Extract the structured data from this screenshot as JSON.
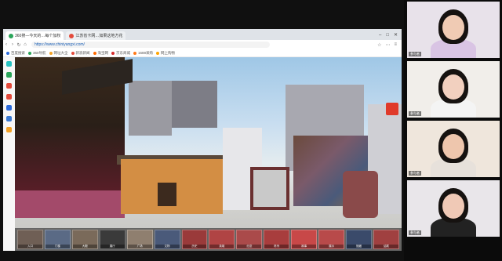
{
  "browser": {
    "tabs": [
      {
        "label": "360搜—今天的…每个加权",
        "color": "#2aa55a"
      },
      {
        "label": "江苏省卡网…如果这地方花",
        "color": "#e34a3b"
      }
    ],
    "url": "https://www.chiniyangxi.com/",
    "bookmarks": [
      {
        "label": "百度搜索",
        "color": "#2b6bdc"
      },
      {
        "label": "360导航",
        "color": "#2aa55a"
      },
      {
        "label": "网址大全",
        "color": "#f2a227"
      },
      {
        "label": "新浪新闻",
        "color": "#e34a3b"
      },
      {
        "label": "淘宝网",
        "color": "#ff6a00"
      },
      {
        "label": "京东商城",
        "color": "#d52b2b"
      },
      {
        "label": "1688采购",
        "color": "#ff7a1a"
      },
      {
        "label": "网上购物",
        "color": "#ffa500"
      }
    ]
  },
  "panorama": {
    "thumbnails": [
      {
        "label": "入口",
        "color": "#6f5f55"
      },
      {
        "label": "门楼",
        "color": "#5a6a85"
      },
      {
        "label": "大殿",
        "color": "#7a6a5a"
      },
      {
        "label": "展厅",
        "color": "#3a3a3a"
      },
      {
        "label": "广场",
        "color": "#8f7f6f"
      },
      {
        "label": "文物",
        "color": "#4a5a7a"
      },
      {
        "label": "历史",
        "color": "#9a3a3a"
      },
      {
        "label": "英雄",
        "color": "#b04444"
      },
      {
        "label": "纪念",
        "color": "#aa4a4a"
      },
      {
        "label": "陈列",
        "color": "#a83d3d"
      },
      {
        "label": "故事",
        "color": "#c84848"
      },
      {
        "label": "展示",
        "color": "#b84a4a"
      },
      {
        "label": "馆藏",
        "color": "#3a4a6a"
      },
      {
        "label": "结尾",
        "color": "#a04040"
      }
    ]
  },
  "participants": [
    {
      "label": "参与者",
      "bg": "#e8e2ea",
      "skin": "#f0cbb4",
      "shirt": "#d9c4e4"
    },
    {
      "label": "参与者",
      "bg": "#f1eeea",
      "skin": "#f2d0bf",
      "shirt": "#f4f4f4"
    },
    {
      "label": "参与者",
      "bg": "#efe6dc",
      "skin": "#eec6ad",
      "shirt": "#e7e1db"
    },
    {
      "label": "参与者",
      "bg": "#e9e6ea",
      "skin": "#f0c9b6",
      "shirt": "#222222"
    }
  ]
}
